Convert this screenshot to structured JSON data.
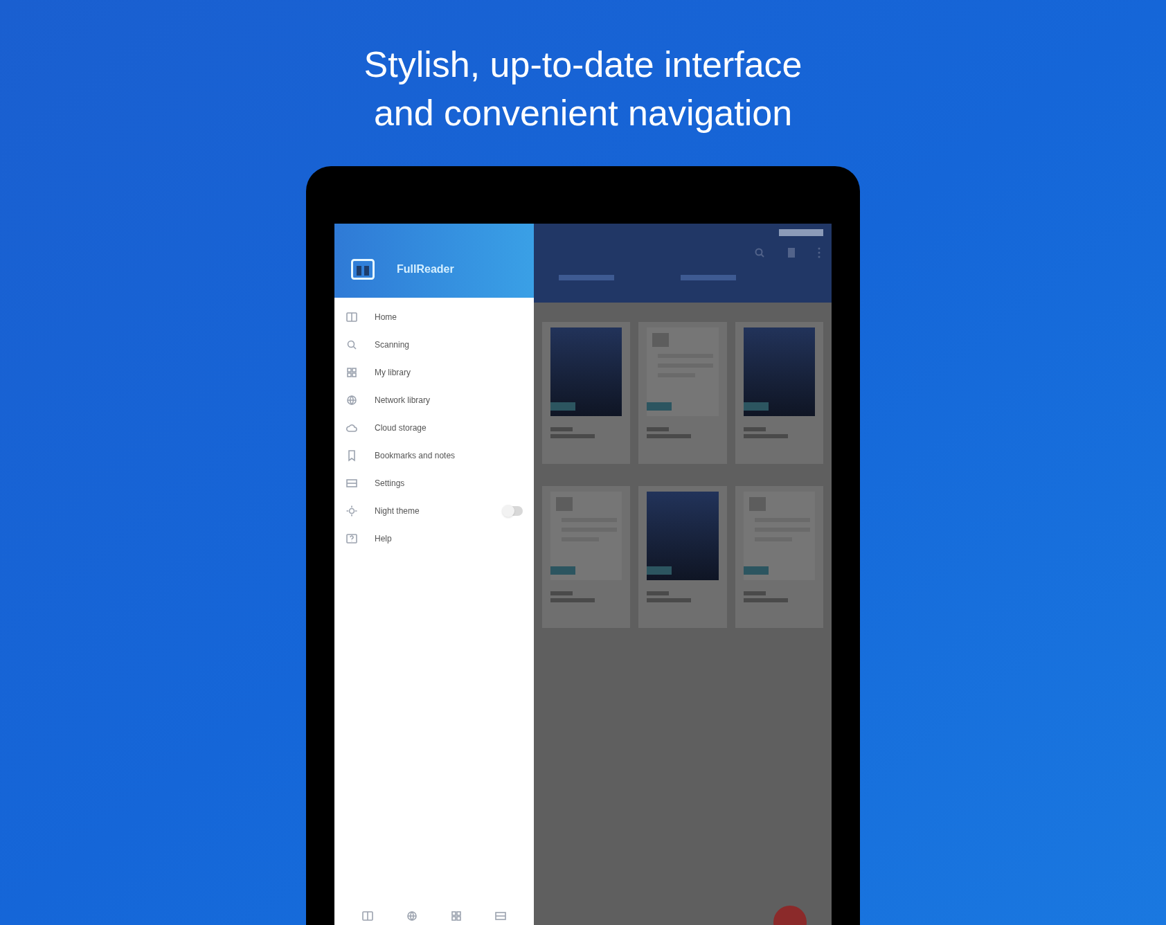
{
  "headline": [
    "Stylish, up-to-date interface",
    "and convenient navigation"
  ],
  "drawer": {
    "app_name": "FullReader",
    "items": [
      {
        "label": "Home",
        "kind": "link"
      },
      {
        "label": "Scanning",
        "kind": "link"
      },
      {
        "label": "My library",
        "kind": "link"
      },
      {
        "label": "Network library",
        "kind": "link"
      },
      {
        "label": "Cloud storage",
        "kind": "link"
      },
      {
        "label": "Bookmarks and notes",
        "kind": "link"
      },
      {
        "label": "Settings",
        "kind": "link"
      },
      {
        "label": "Night theme",
        "kind": "toggle",
        "on": false
      },
      {
        "label": "Help",
        "kind": "link"
      }
    ]
  },
  "books": [
    {
      "kind": "cover"
    },
    {
      "kind": "text"
    },
    {
      "kind": "cover"
    },
    {
      "kind": "text"
    },
    {
      "kind": "cover"
    },
    {
      "kind": "text"
    }
  ]
}
